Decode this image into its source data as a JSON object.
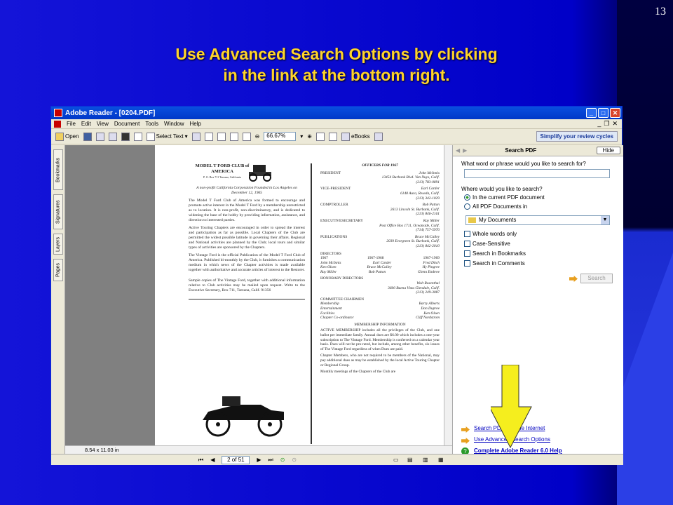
{
  "slide": {
    "page_number": "13",
    "title_line1": "Use Advanced Search Options by clicking",
    "title_line2": "in the link at the bottom right."
  },
  "window": {
    "title": "Adobe Reader - [0204.PDF]",
    "menu": [
      "File",
      "Edit",
      "View",
      "Document",
      "Tools",
      "Window",
      "Help"
    ],
    "toolbar": {
      "open_label": "Open",
      "select_text_label": "Select Text",
      "zoom": "66.67%",
      "ebooks_label": "eBooks",
      "simplify_label": "Simplify your review cycles"
    },
    "nav_tabs": [
      "Bookmarks",
      "Signatures",
      "Layers",
      "Pages"
    ],
    "page_size": "8.54 x 11.03 in",
    "page_nav": "2 of 51"
  },
  "document": {
    "club_title": "MODEL T FORD CLUB of AMERICA",
    "club_address": "P. O. Box 711 Tarzana, California",
    "intro": "A non-profit California Corporation Founded in Los Angeles on December 12, 1965",
    "para1": "The Model T Ford Club of America was formed to encourage and promote active interest in the Model T Ford by a membership unrestricted as to location. It is non-profit, non-discriminatory, and is dedicated to widening the base of the hobby by providing information, assistance, and direction to interested parties.",
    "para2": "Active Touring Chapters are encouraged in order to spread the interest and participation as far as possible. Local Chapters of the Club are permitted the widest possible latitude in governing their affairs. Regional and National activities are planned by the Club; local tours and similar types of activities are sponsored by the Chapters.",
    "para3": "The Vintage Ford is the official Publication of the Model T Ford Club of America. Published bi-monthly by the Club, it furnishes a communication medium in which news of the Chapter activities is made available together with authoritative and accurate articles of interest to the Restorer.",
    "para4": "Sample copies of The Vintage Ford, together with additional information relative to Club activities may be mailed upon request. Write to the Executive Secretary, Box 711, Tarzana, Calif. 91356",
    "officers_title": "OFFICERS FOR 1967",
    "officers": [
      {
        "role": "PRESIDENT",
        "name": "John McInnis",
        "addr": "13454 Burbank Blvd. Van Nuys, Calif.",
        "phone": "(213) 783-0891"
      },
      {
        "role": "VICE-PRESIDENT",
        "name": "Earl Carder",
        "addr": "6148 Aura, Reseda, Calif.",
        "phone": "(213) 342-1029"
      },
      {
        "role": "COMPTROLLER",
        "name": "Bob Patton",
        "addr": "2613 Lincoln St. Burbank, Calif.",
        "phone": "(213) 846-2161"
      },
      {
        "role": "EXECUTIVESECRETARY",
        "name": "Ray Miller",
        "addr": "Post Office Box 1711, Oceanside, Calif.",
        "phone": "(714) 757-5976"
      },
      {
        "role": "PUBLICATIONS",
        "name": "Bruce McCalley",
        "addr": "2039 Evergreen St. Burbank, Calif.",
        "phone": "(213) 842-2010"
      }
    ],
    "directors_title": "DIRECTORS",
    "directors": [
      [
        "1967",
        "1967-1968",
        "1967-1969"
      ],
      [
        "John McInnis",
        "Earl Carder",
        "Fred Ditch"
      ],
      [
        "Ken Olsen",
        "Bruce McCalley",
        "Hy Pingree"
      ],
      [
        "Ray Miller",
        "Bob Patton",
        "Glenn Embree"
      ]
    ],
    "honorary_title": "HONORARY DIRECTORS",
    "honorary_name": "Walt Rosenthal",
    "honorary_addr": "3600 Buena Vista Glendale, Calif.",
    "honorary_phone": "(213) 249-3087",
    "committee_title": "COMMITTEE CHAIRMEN",
    "committee": [
      [
        "Membership",
        "Barry Alberts"
      ],
      [
        "Entertainment",
        "Don Dupree"
      ],
      [
        "Facilities",
        "Ken Olsen"
      ],
      [
        "Chapter Co-ordinator",
        "Cliff Nordstrom"
      ]
    ],
    "membership_title": "MEMBERSHIP INFORMATION",
    "membership_text": "ACTIVE MEMBERSHIP includes all the privileges of the Club, and one ballot per immediate family. Annual dues are $6.00 which includes a one-year subscription to The Vintage Ford. Membership is conferred on a calendar year basis. Dues will not be pro-rated, but include, among other benefits, six issues of The Vintage Ford regardless of when Dues are paid.",
    "chapter_text": "Chapter Members, who are not required to be members of the National, may pay additional dues as may be established by the local Active Touring Chapter or Regional Group.",
    "monthly_text": "Monthly meetings of the Chapters of the Club are"
  },
  "search_panel": {
    "title": "Search PDF",
    "hide_label": "Hide",
    "question": "What word or phrase would you like to search for?",
    "where_label": "Where would you like to search?",
    "option_current": "In the current PDF document",
    "option_all": "All PDF Documents in",
    "folder": "My Documents",
    "checkboxes": [
      "Whole words only",
      "Case-Sensitive",
      "Search in Bookmarks",
      "Search in Comments"
    ],
    "search_button": "Search",
    "link_internet": "Search PDFs on the Internet",
    "link_advanced": "Use Advanced Search Options",
    "link_help": "Complete Adobe Reader 6.0 Help"
  },
  "colors": {
    "slide_bg": "#0000c8",
    "title": "#ffd42a",
    "pointer_arrow": "#f5ee1e",
    "link": "#0000c0"
  }
}
